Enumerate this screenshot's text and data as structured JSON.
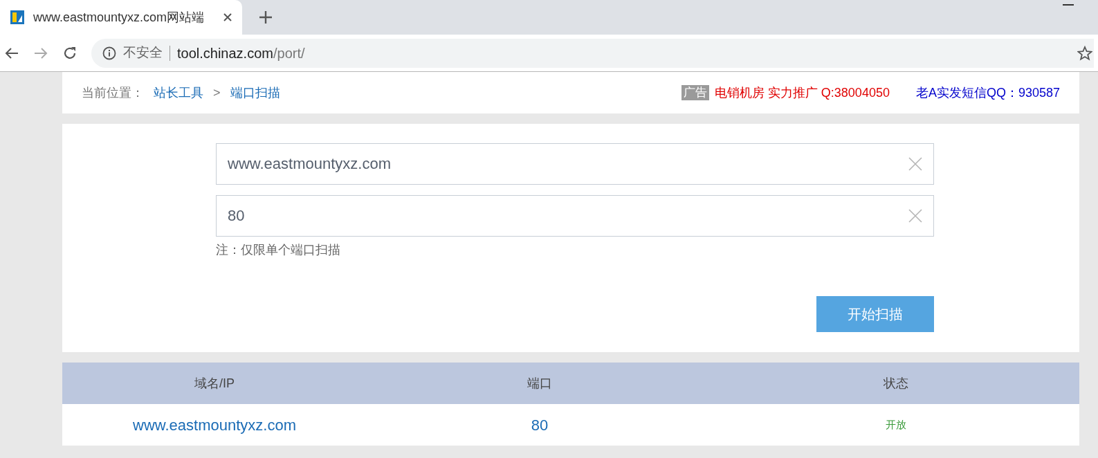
{
  "browser": {
    "tab_title": "www.eastmountyxz.com网站端",
    "security": "不安全",
    "url_host": "tool.chinaz.com",
    "url_path": "/port/"
  },
  "breadcrumb": {
    "label": "当前位置：",
    "items": [
      "站长工具",
      "端口扫描"
    ],
    "separator": ">"
  },
  "ads": {
    "tag": "广告",
    "red_text": "电销机房 实力推广 Q:38004050",
    "blue_text": "老A实发短信QQ：930587"
  },
  "form": {
    "host_value": "www.eastmountyxz.com",
    "port_value": "80",
    "note": "注：仅限单个端口扫描",
    "button": "开始扫描"
  },
  "table": {
    "columns": [
      "域名/IP",
      "端口",
      "状态"
    ],
    "rows": [
      {
        "host": "www.eastmountyxz.com",
        "port": "80",
        "status": "开放"
      }
    ]
  }
}
